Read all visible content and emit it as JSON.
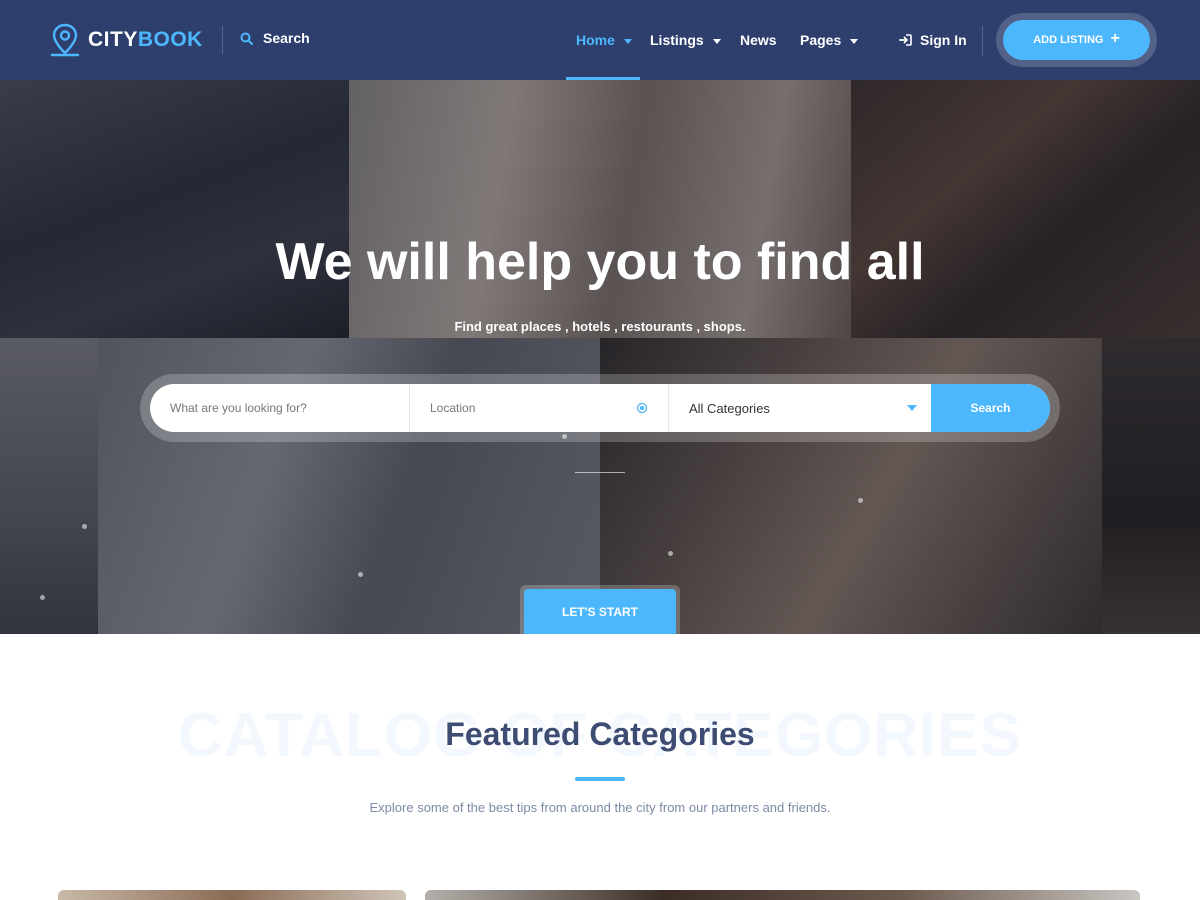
{
  "header": {
    "logo_main": "CITY",
    "logo_accent": "BOOK",
    "search_label": "Search",
    "nav": [
      {
        "label": "Home",
        "has_dropdown": true,
        "active": true
      },
      {
        "label": "Listings",
        "has_dropdown": true
      },
      {
        "label": "News",
        "has_dropdown": false
      },
      {
        "label": "Pages",
        "has_dropdown": true
      }
    ],
    "sign_in": "Sign In",
    "add_listing": "ADD LISTING",
    "add_listing_icon": "+"
  },
  "hero": {
    "title": "We will help you to find all",
    "subtitle": "Find great places , hotels , restourants , shops.",
    "search": {
      "what_placeholder": "What are you looking for?",
      "location_placeholder": "Location",
      "category_selected": "All Categories",
      "button": "Search"
    },
    "start_button": "LET'S START"
  },
  "section": {
    "background_word": "CATALOG OF CATEGORIES",
    "title": "Featured Categories",
    "subtitle": "Explore some of the best tips from around the city from our partners and friends."
  },
  "colors": {
    "header_bg": "#2e3f6e",
    "accent": "#4db7fe",
    "title": "#3e4b72",
    "muted": "#7d8aa6"
  },
  "icons": {
    "logo": "map-pin-icon",
    "search": "search-icon",
    "sign_in": "sign-in-icon",
    "location": "location-target-icon",
    "category": "chevron-down-icon"
  }
}
